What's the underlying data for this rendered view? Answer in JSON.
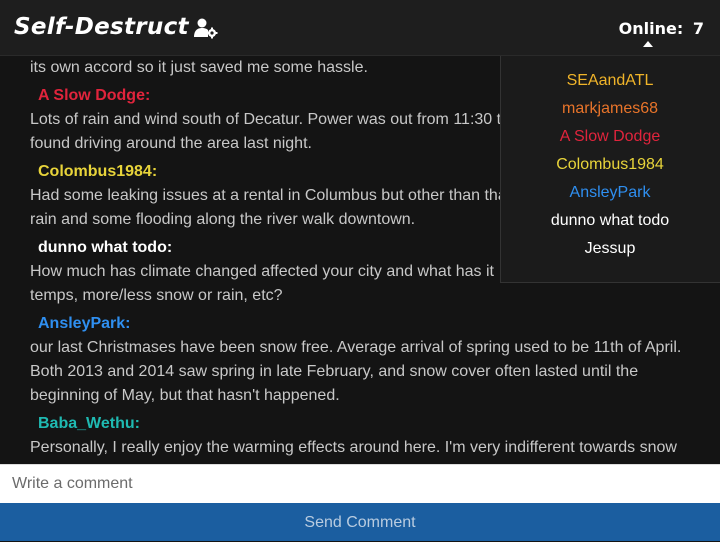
{
  "header": {
    "title": "Self-Destruct",
    "online_label": "Online:",
    "online_count": "7"
  },
  "messages": [
    {
      "lines": [
        "its own accord so it just saved me some hassle."
      ]
    },
    {
      "author": "A Slow Dodge:",
      "color": "#e0243c",
      "lines": [
        "Lots of rain and wind south of Decatur. Power was out from 11:30 t",
        "found driving around the area last night."
      ]
    },
    {
      "author": "Colombus1984:",
      "color": "#e8d43a",
      "lines": [
        "Had some leaking issues at a rental in Columbus but other than tha",
        "rain and some flooding along the river walk downtown."
      ]
    },
    {
      "author": "dunno what todo:",
      "color": "#ffffff",
      "lines": [
        "How much has climate changed affected your city and what has it",
        "temps, more/less snow or rain, etc?"
      ]
    },
    {
      "author": "AnsleyPark:",
      "color": "#2f8ff0",
      "lines": [
        "our last Christmases have been snow free. Average arrival of spring used to be 11th of April.",
        "Both 2013 and 2014 saw spring in late February, and snow cover often lasted until the",
        "beginning of May, but that hasn't happened."
      ]
    },
    {
      "author": "Baba_Wethu:",
      "color": "#1fbab2",
      "lines": [
        "Personally, I really enjoy the warming effects around here. I'm very indifferent towards snow"
      ]
    }
  ],
  "online_users": [
    {
      "name": "SEAandATL",
      "color": "#f0b429"
    },
    {
      "name": "markjames68",
      "color": "#e8742a"
    },
    {
      "name": "A Slow Dodge",
      "color": "#e0243c"
    },
    {
      "name": "Colombus1984",
      "color": "#e8d43a"
    },
    {
      "name": "AnsleyPark",
      "color": "#2f8ff0"
    },
    {
      "name": "dunno what todo",
      "color": "#ffffff"
    },
    {
      "name": "Jessup",
      "color": "#ffffff"
    }
  ],
  "composer": {
    "placeholder": "Write a comment",
    "send_label": "Send Comment"
  },
  "icons": {
    "user_settings": "user-gear-icon",
    "dropdown": "caret-up-icon"
  }
}
